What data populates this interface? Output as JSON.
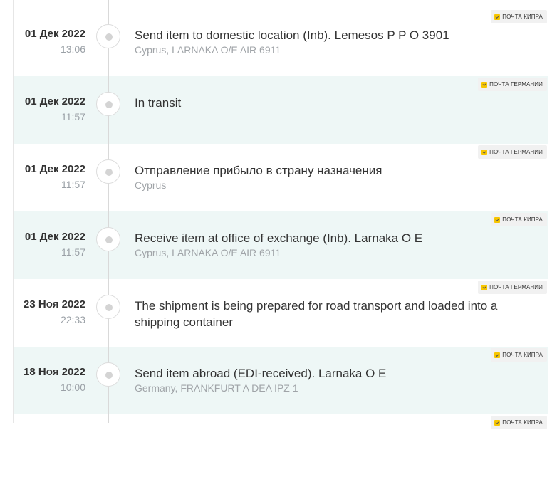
{
  "events": [
    {
      "date": "01 Дек 2022",
      "time": "13:06",
      "title": "Send item to domestic location (Inb). Lemesos P P O 3901",
      "subtitle": "Cyprus, LARNAKA O/E AIR 6911",
      "carrier": "ПОЧТА КИПРА"
    },
    {
      "date": "01 Дек 2022",
      "time": "11:57",
      "title": "In transit",
      "subtitle": "",
      "carrier": "ПОЧТА ГЕРМАНИИ"
    },
    {
      "date": "01 Дек 2022",
      "time": "11:57",
      "title": "Отправление прибыло в страну назначения",
      "subtitle": "Cyprus",
      "carrier": "ПОЧТА ГЕРМАНИИ"
    },
    {
      "date": "01 Дек 2022",
      "time": "11:57",
      "title": "Receive item at office of exchange (Inb). Larnaka O E",
      "subtitle": "Cyprus, LARNAKA O/E AIR 6911",
      "carrier": "ПОЧТА КИПРА"
    },
    {
      "date": "23 Ноя 2022",
      "time": "22:33",
      "title": "The shipment is being prepared for road transport and loaded into a shipping container",
      "subtitle": "",
      "carrier": "ПОЧТА ГЕРМАНИИ"
    },
    {
      "date": "18 Ноя 2022",
      "time": "10:00",
      "title": "Send item abroad (EDI-received). Larnaka O E",
      "subtitle": "Germany, FRANKFURT A DEA IPZ 1",
      "carrier": "ПОЧТА КИПРА"
    },
    {
      "date": "",
      "time": "",
      "title": "",
      "subtitle": "",
      "carrier": "ПОЧТА КИПРА"
    }
  ],
  "colors": {
    "alt_row": "#eef7f6",
    "badge_bg": "#f1f1f1",
    "post_icon": "#f7c600"
  }
}
